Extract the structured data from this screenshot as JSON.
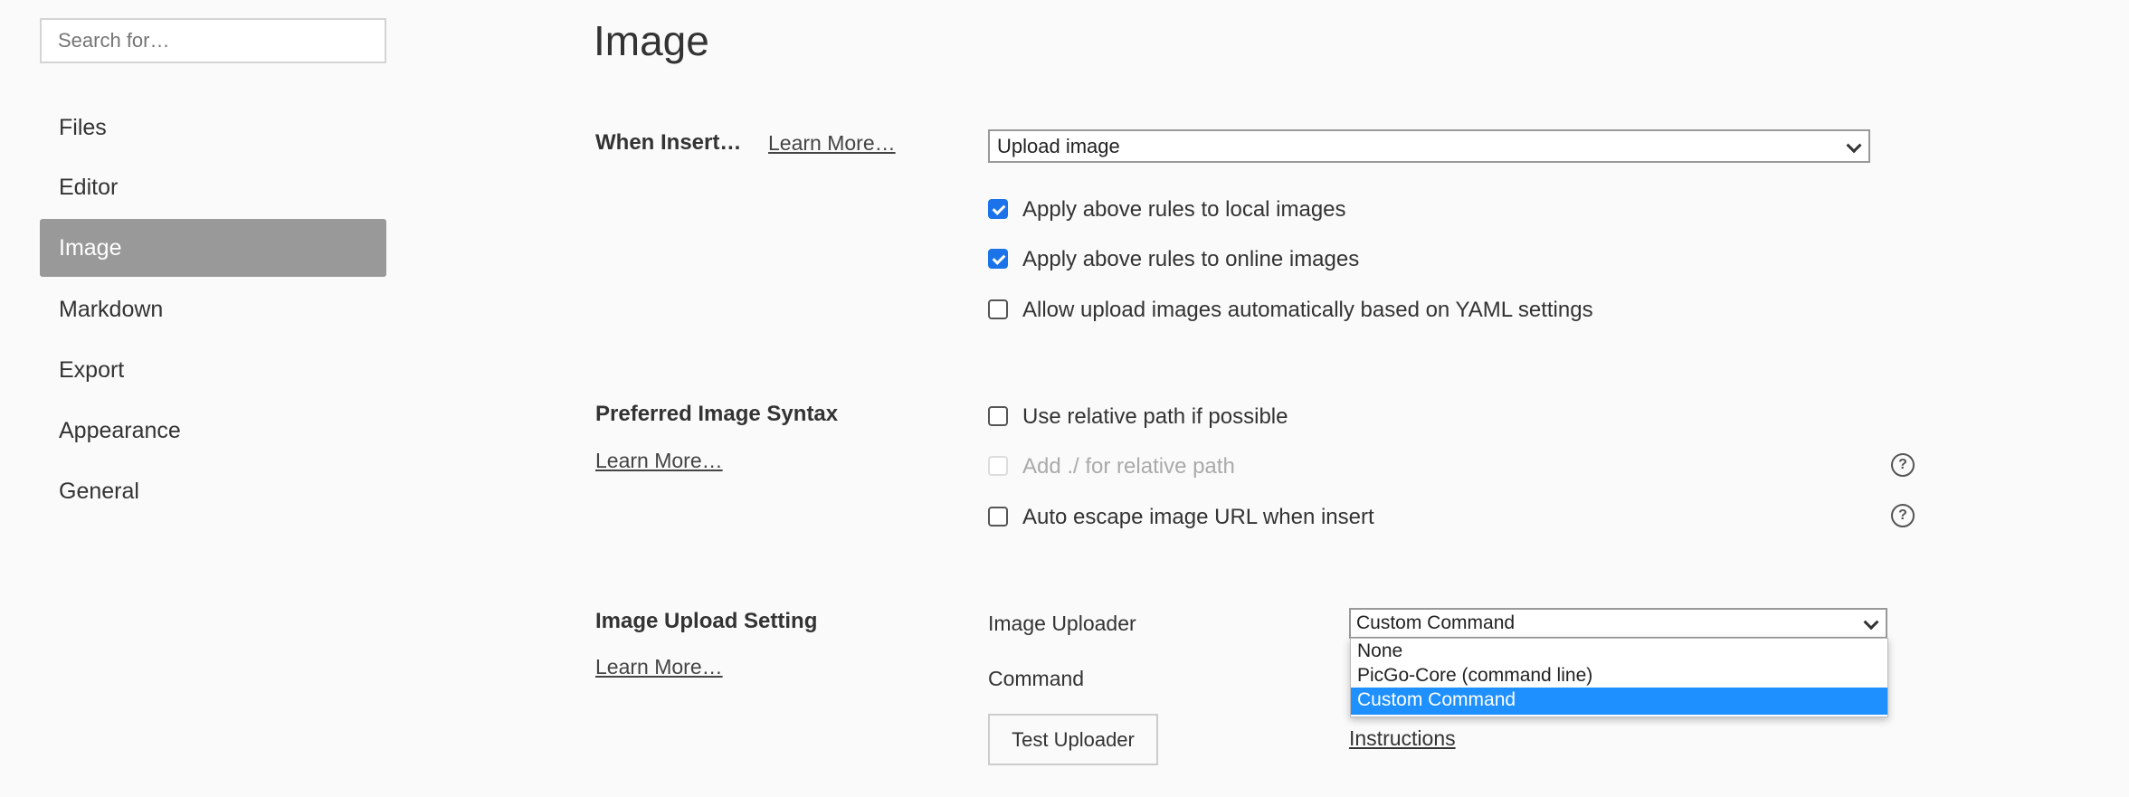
{
  "sidebar": {
    "search_placeholder": "Search for…",
    "items": [
      {
        "label": "Files"
      },
      {
        "label": "Editor"
      },
      {
        "label": "Image",
        "active": true
      },
      {
        "label": "Markdown"
      },
      {
        "label": "Export"
      },
      {
        "label": "Appearance"
      },
      {
        "label": "General"
      }
    ]
  },
  "main": {
    "title": "Image",
    "when_insert": {
      "label": "When Insert…",
      "learn_more": "Learn More…",
      "select_value": "Upload image",
      "options": [
        {
          "label": "Apply above rules to local images",
          "checked": true
        },
        {
          "label": "Apply above rules to online images",
          "checked": true
        },
        {
          "label": "Allow upload images automatically based on YAML settings",
          "checked": false
        }
      ]
    },
    "syntax": {
      "label": "Preferred Image Syntax",
      "learn_more": "Learn More…",
      "options": [
        {
          "label": "Use relative path if possible",
          "checked": false
        },
        {
          "label": "Add ./ for relative path",
          "checked": false,
          "disabled": true
        },
        {
          "label": "Auto escape image URL when insert",
          "checked": false
        }
      ],
      "help_glyph": "?"
    },
    "upload": {
      "label": "Image Upload Setting",
      "learn_more": "Learn More…",
      "uploader_label": "Image Uploader",
      "uploader_value": "Custom Command",
      "dropdown_options": [
        "None",
        "PicGo-Core (command line)",
        "Custom Command"
      ],
      "command_label": "Command",
      "test_button": "Test Uploader",
      "instructions": "Instructions"
    }
  },
  "colors": {
    "accent": "#1a73e8",
    "highlight": "#1e90ff",
    "active_nav": "#999999"
  }
}
